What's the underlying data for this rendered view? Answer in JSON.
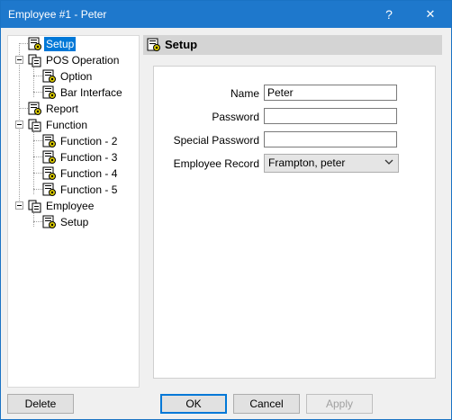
{
  "window": {
    "title": "Employee #1 - Peter",
    "help_glyph": "?",
    "close_glyph": "✕"
  },
  "tree": [
    {
      "id": "setup",
      "label": "Setup",
      "depth": 0,
      "expander": false,
      "selected": true,
      "icon": "gear-page-icon"
    },
    {
      "id": "pos-operation",
      "label": "POS Operation",
      "depth": 0,
      "expander": true,
      "icon": "folder-page-icon"
    },
    {
      "id": "option",
      "label": "Option",
      "depth": 1,
      "expander": false,
      "icon": "gear-page-icon"
    },
    {
      "id": "bar-interface",
      "label": "Bar Interface",
      "depth": 1,
      "expander": false,
      "icon": "gear-page-icon"
    },
    {
      "id": "report",
      "label": "Report",
      "depth": 0,
      "expander": false,
      "icon": "gear-page-icon"
    },
    {
      "id": "function",
      "label": "Function",
      "depth": 0,
      "expander": true,
      "icon": "folder-page-icon"
    },
    {
      "id": "function-2",
      "label": "Function - 2",
      "depth": 1,
      "expander": false,
      "icon": "gear-page-icon"
    },
    {
      "id": "function-3",
      "label": "Function - 3",
      "depth": 1,
      "expander": false,
      "icon": "gear-page-icon"
    },
    {
      "id": "function-4",
      "label": "Function - 4",
      "depth": 1,
      "expander": false,
      "icon": "gear-page-icon"
    },
    {
      "id": "function-5",
      "label": "Function - 5",
      "depth": 1,
      "expander": false,
      "icon": "gear-page-icon"
    },
    {
      "id": "employee",
      "label": "Employee",
      "depth": 0,
      "expander": true,
      "icon": "folder-page-icon"
    },
    {
      "id": "employee-setup",
      "label": "Setup",
      "depth": 1,
      "expander": false,
      "icon": "gear-page-icon"
    }
  ],
  "section": {
    "title": "Setup",
    "icon": "gear-page-icon"
  },
  "form": {
    "name_label": "Name",
    "name_value": "Peter",
    "password_label": "Password",
    "password_value": "",
    "special_password_label": "Special Password",
    "special_password_value": "",
    "employee_record_label": "Employee Record",
    "employee_record_value": "Frampton, peter"
  },
  "buttons": {
    "delete": "Delete",
    "ok": "OK",
    "cancel": "Cancel",
    "apply": "Apply"
  },
  "colors": {
    "titlebar": "#1e78cc",
    "selection": "#0078d7"
  }
}
